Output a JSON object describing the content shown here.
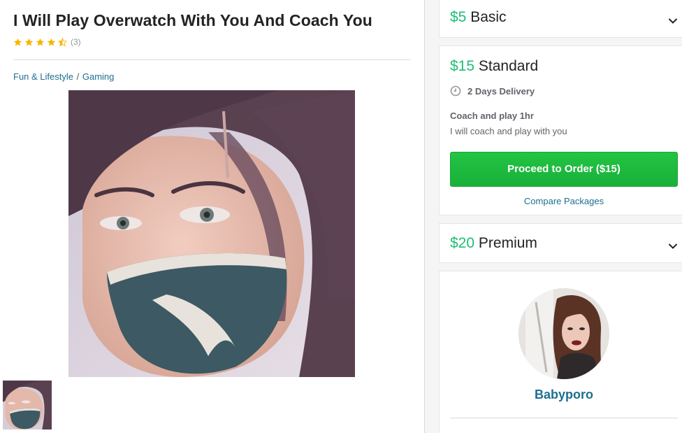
{
  "gig": {
    "title": "I Will Play Overwatch With You And Coach You",
    "rating_stars": 4.5,
    "rating_count": "(3)",
    "breadcrumb": {
      "category": "Fun & Lifestyle",
      "separator": "/",
      "subcategory": "Gaming"
    },
    "colors": {
      "star": "#f7b500",
      "link": "#1d6f8f"
    }
  },
  "packages": {
    "basic": {
      "price": "$5",
      "name": "Basic"
    },
    "standard": {
      "price": "$15",
      "name": "Standard",
      "delivery": "2 Days Delivery",
      "subtitle": "Coach and play 1hr",
      "description": "I will coach and play with you",
      "order_button": "Proceed to Order ($15)",
      "compare_link": "Compare Packages"
    },
    "premium": {
      "price": "$20",
      "name": "Premium"
    },
    "colors": {
      "price": "#1dbf73",
      "button": "#1dbf3f"
    }
  },
  "seller": {
    "name": "Babyporo"
  },
  "icons": [
    "star-icon",
    "half-star-icon",
    "chevron-down-icon",
    "clock-icon"
  ]
}
